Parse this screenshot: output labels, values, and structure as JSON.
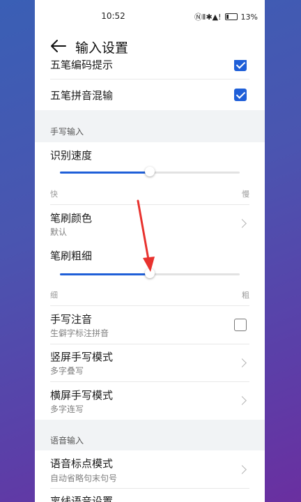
{
  "status": {
    "time": "10:52",
    "battery": "13%",
    "icons": "ⓃⅡ✱▲!"
  },
  "header": {
    "title": "输入设置"
  },
  "rows": {
    "wubi_hint": "五笔编码提示",
    "wubi_mixed": "五笔拼音混输"
  },
  "handwriting": {
    "group_label": "手写输入",
    "recognition_speed": {
      "label": "识别速度",
      "left": "快",
      "right": "慢",
      "value": 0.5
    },
    "brush_color": {
      "title": "笔刷颜色",
      "subtitle": "默认"
    },
    "brush_width": {
      "label": "笔刷粗细",
      "left": "细",
      "right": "粗",
      "value": 0.5
    },
    "phonetic": {
      "title": "手写注音",
      "subtitle": "生僻字标注拼音"
    },
    "portrait_mode": {
      "title": "竖屏手写模式",
      "subtitle": "多字叠写"
    },
    "landscape_mode": {
      "title": "横屏手写模式",
      "subtitle": "多字连写"
    }
  },
  "voice": {
    "group_label": "语音输入",
    "punctuation": {
      "title": "语音标点模式",
      "subtitle": "自动省略句末句号"
    },
    "offline": {
      "title": "离线语音设置"
    }
  },
  "colors": {
    "accent": "#1f5fd8",
    "annotation_arrow": "#e8322e"
  }
}
